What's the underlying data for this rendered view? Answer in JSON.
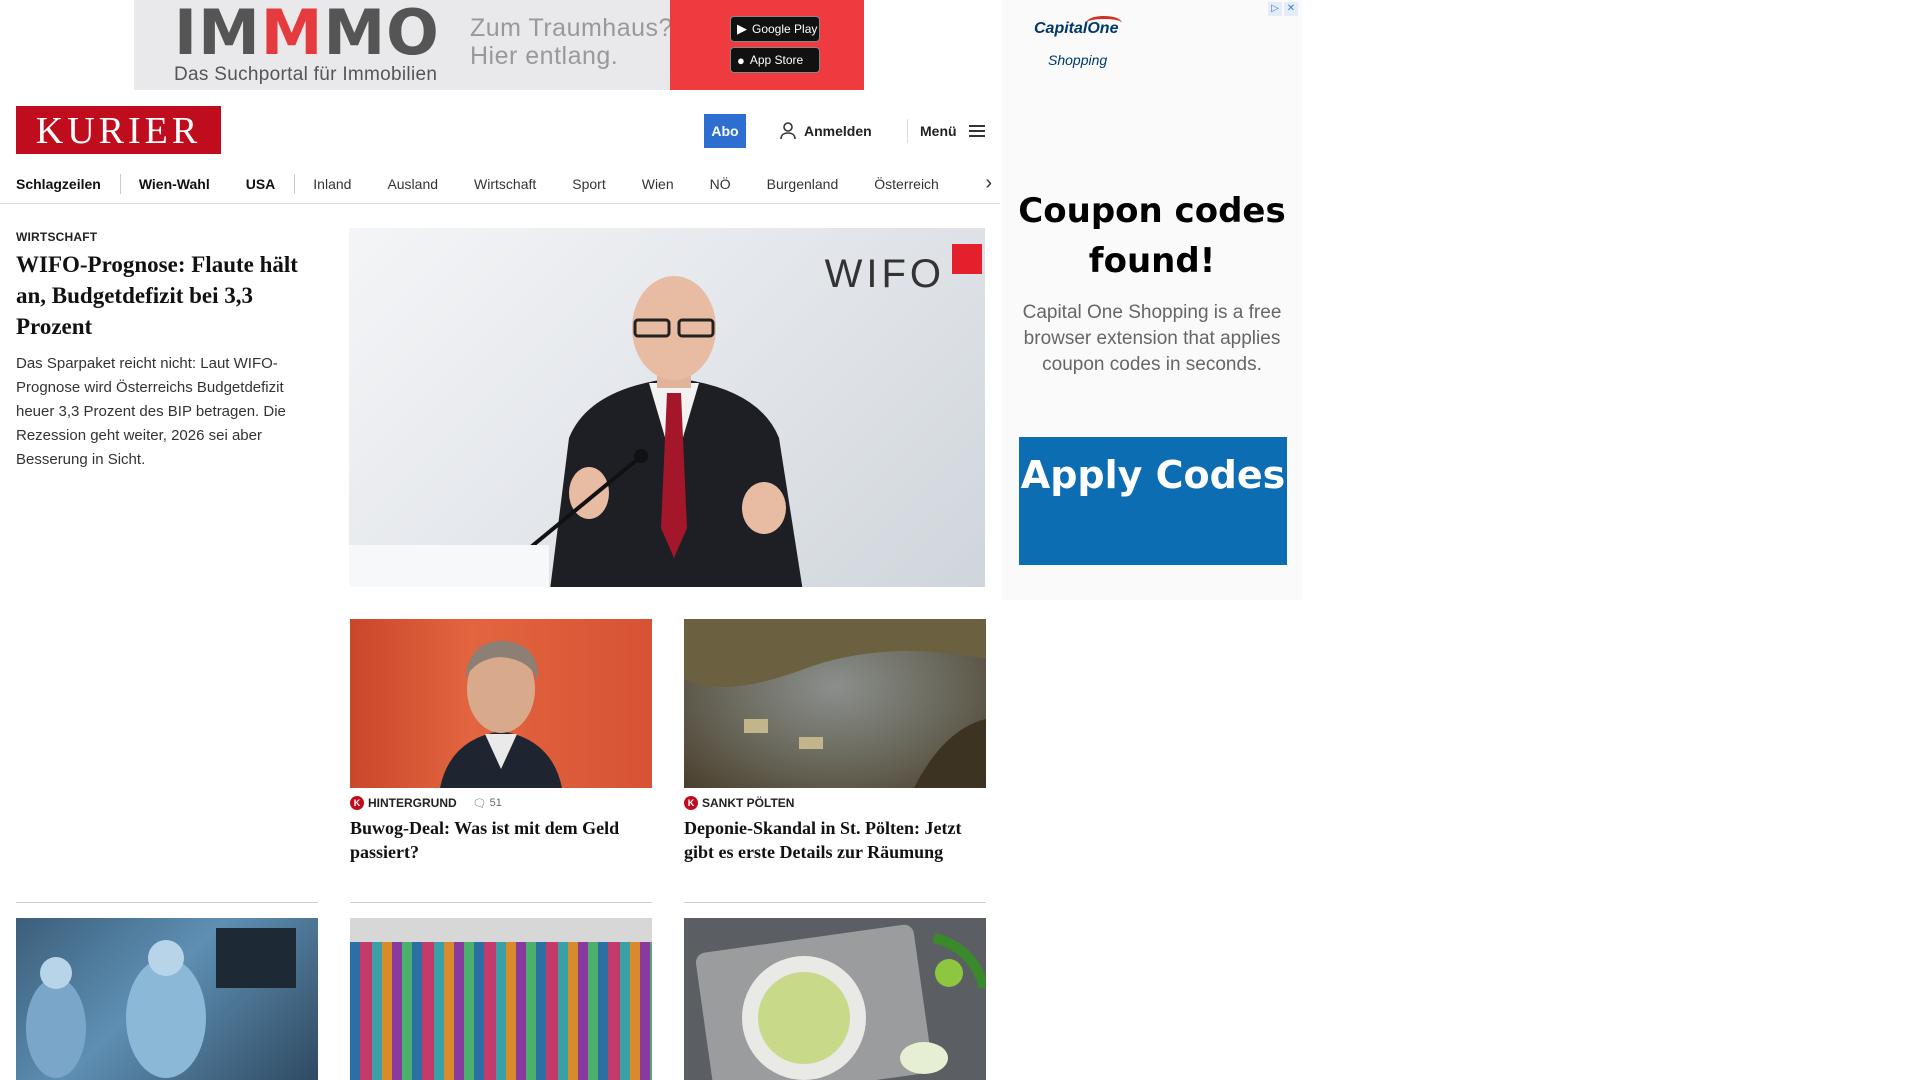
{
  "top_ad": {
    "logo_part1": "IM",
    "logo_part2": "M",
    "logo_part3": "MO",
    "subline": "Das Suchportal für Immobilien",
    "claim_line1": "Zum Traumhaus?",
    "claim_line2": "Hier entlang.",
    "google_play": "Google Play",
    "app_store": "App Store"
  },
  "header": {
    "brand": "KURIER",
    "abo": "Abo",
    "login": "Anmelden",
    "menu": "Menü"
  },
  "nav": {
    "items": [
      "Schlagzeilen",
      "Wien-Wahl",
      "USA",
      "Inland",
      "Ausland",
      "Wirtschaft",
      "Sport",
      "Wien",
      "NÖ",
      "Burgenland",
      "Österreich"
    ]
  },
  "lead": {
    "kicker": "WIRTSCHAFT",
    "title": "WIFO-Prognose: Flaute hält an, Budgetdefizit bei 3,3 Prozent",
    "teaser": "Das Sparpaket reicht nicht: Laut WIFO-Prognose wird Österreichs Budgetdefizit heuer 3,3 Prozent des BIP betragen. Die Rezession geht weiter, 2026 sei aber Besserung in Sicht.",
    "image_logo": "WIFO"
  },
  "cards": [
    {
      "badge": "K",
      "kicker": "HINTERGRUND",
      "comments": "51",
      "title": "Buwog-Deal: Was ist mit dem Geld passiert?"
    },
    {
      "badge": "K",
      "kicker": "SANKT PÖLTEN",
      "title": "Deponie-Skandal in St. Pölten: Jetzt gibt es erste Details zur Räumung"
    }
  ],
  "side_ad": {
    "brand": "CapitalOne",
    "brand_sub": "Shopping",
    "headline": "Coupon codes found!",
    "body": "Capital One Shopping is a free browser extension that applies coupon codes in seconds.",
    "cta": "Apply Codes",
    "adchoices_1": "▷",
    "adchoices_2": "✕"
  },
  "colors": {
    "brand_red": "#c00d1e",
    "abo_blue": "#2d6fd1",
    "ad_red": "#ef3b3f",
    "cta_blue": "#0d6db3"
  }
}
